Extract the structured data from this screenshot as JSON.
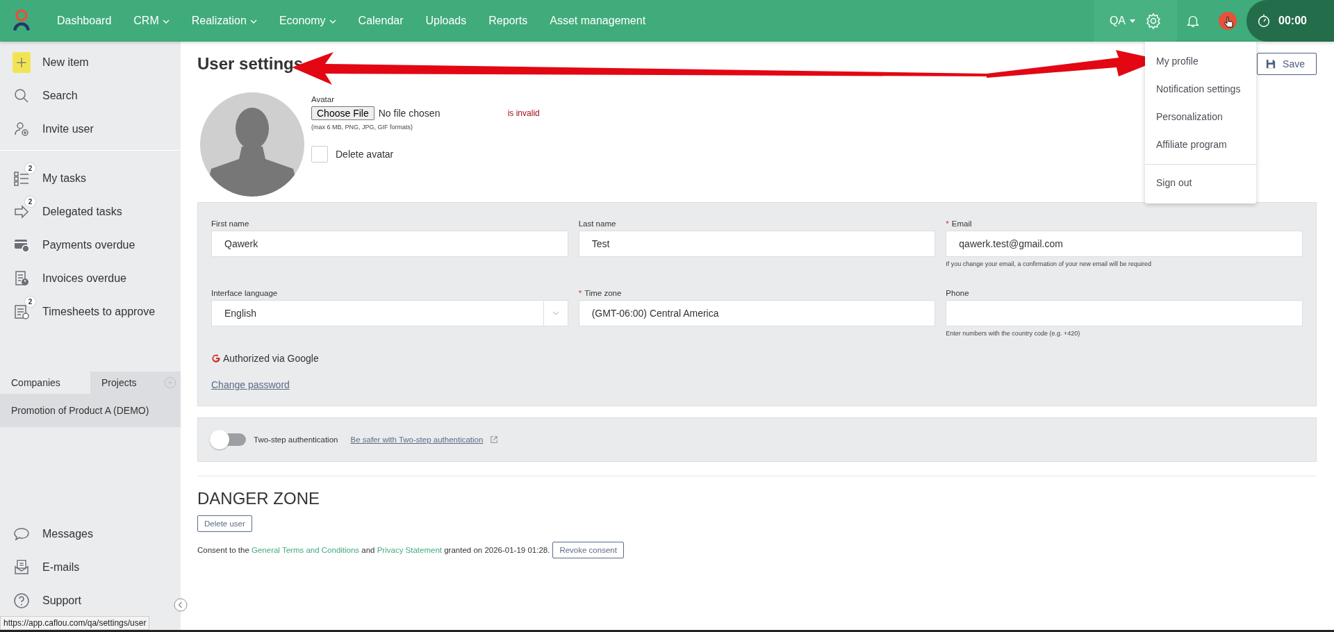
{
  "topbar": {
    "nav": [
      {
        "label": "Dashboard",
        "dropdown": false
      },
      {
        "label": "CRM",
        "dropdown": true
      },
      {
        "label": "Realization",
        "dropdown": true
      },
      {
        "label": "Economy",
        "dropdown": true
      },
      {
        "label": "Calendar",
        "dropdown": false
      },
      {
        "label": "Uploads",
        "dropdown": false
      },
      {
        "label": "Reports",
        "dropdown": false
      },
      {
        "label": "Asset management",
        "dropdown": false
      }
    ],
    "workspace": "QA",
    "timer": "00:00"
  },
  "sidebar": {
    "actions": [
      {
        "label": "New item"
      },
      {
        "label": "Search"
      },
      {
        "label": "Invite user"
      }
    ],
    "shortcuts": [
      {
        "label": "My tasks",
        "badge": "2"
      },
      {
        "label": "Delegated tasks",
        "badge": "2"
      },
      {
        "label": "Payments overdue"
      },
      {
        "label": "Invoices overdue"
      },
      {
        "label": "Timesheets to approve",
        "badge": "2"
      }
    ],
    "tabs": [
      {
        "label": "Companies",
        "selected": false
      },
      {
        "label": "Projects",
        "selected": true
      }
    ],
    "projects": [
      "Promotion of Product A (DEMO)"
    ],
    "footer": [
      {
        "label": "Messages"
      },
      {
        "label": "E-mails"
      },
      {
        "label": "Support"
      }
    ]
  },
  "page": {
    "title": "User settings",
    "save": "Save",
    "avatar": {
      "label": "Avatar",
      "file_button": "Choose File",
      "file_status": "No file chosen",
      "error": "is invalid",
      "hint": "(max 6 MB, PNG, JPG, GIF formats)",
      "delete_label": "Delete avatar",
      "delete_checked": false
    },
    "fields": [
      {
        "label": "First name",
        "kind": "text",
        "value": "Qawerk"
      },
      {
        "label": "Last name",
        "kind": "text",
        "value": "Test"
      },
      {
        "label": "Email",
        "required_mark": "*",
        "kind": "text",
        "value": "qawerk.test@gmail.com",
        "hint": "If you change your email, a confirmation of your new email will be required"
      },
      {
        "label": "Interface language",
        "kind": "select",
        "value": "English"
      },
      {
        "label": "Time zone",
        "required_mark": "*",
        "kind": "text",
        "value": "(GMT-06:00) Central America"
      },
      {
        "label": "Phone",
        "kind": "text",
        "hint": "Enter numbers with the country code (e.g. +420)"
      }
    ],
    "google": "Authorized via Google",
    "change_password": "Change password",
    "two_step": {
      "on": false,
      "label": "Two-step authentication",
      "link": "Be safer with Two-step authentication"
    },
    "danger": {
      "title": "DANGER ZONE",
      "delete_button": "Delete user",
      "consent": {
        "before": "Consent to the ",
        "terms_link": "General Terms and Conditions",
        "middle": " and ",
        "privacy_link": "Privacy Statement",
        "after": " granted on 2026-01-19 01:28."
      },
      "revoke_button": "Revoke consent"
    }
  },
  "user_menu": {
    "items": [
      "My profile",
      "Notification settings",
      "Personalization",
      "Affiliate program"
    ],
    "footer_items": [
      "Sign out"
    ]
  },
  "status_url": "https://app.caflou.com/qa/settings/user"
}
